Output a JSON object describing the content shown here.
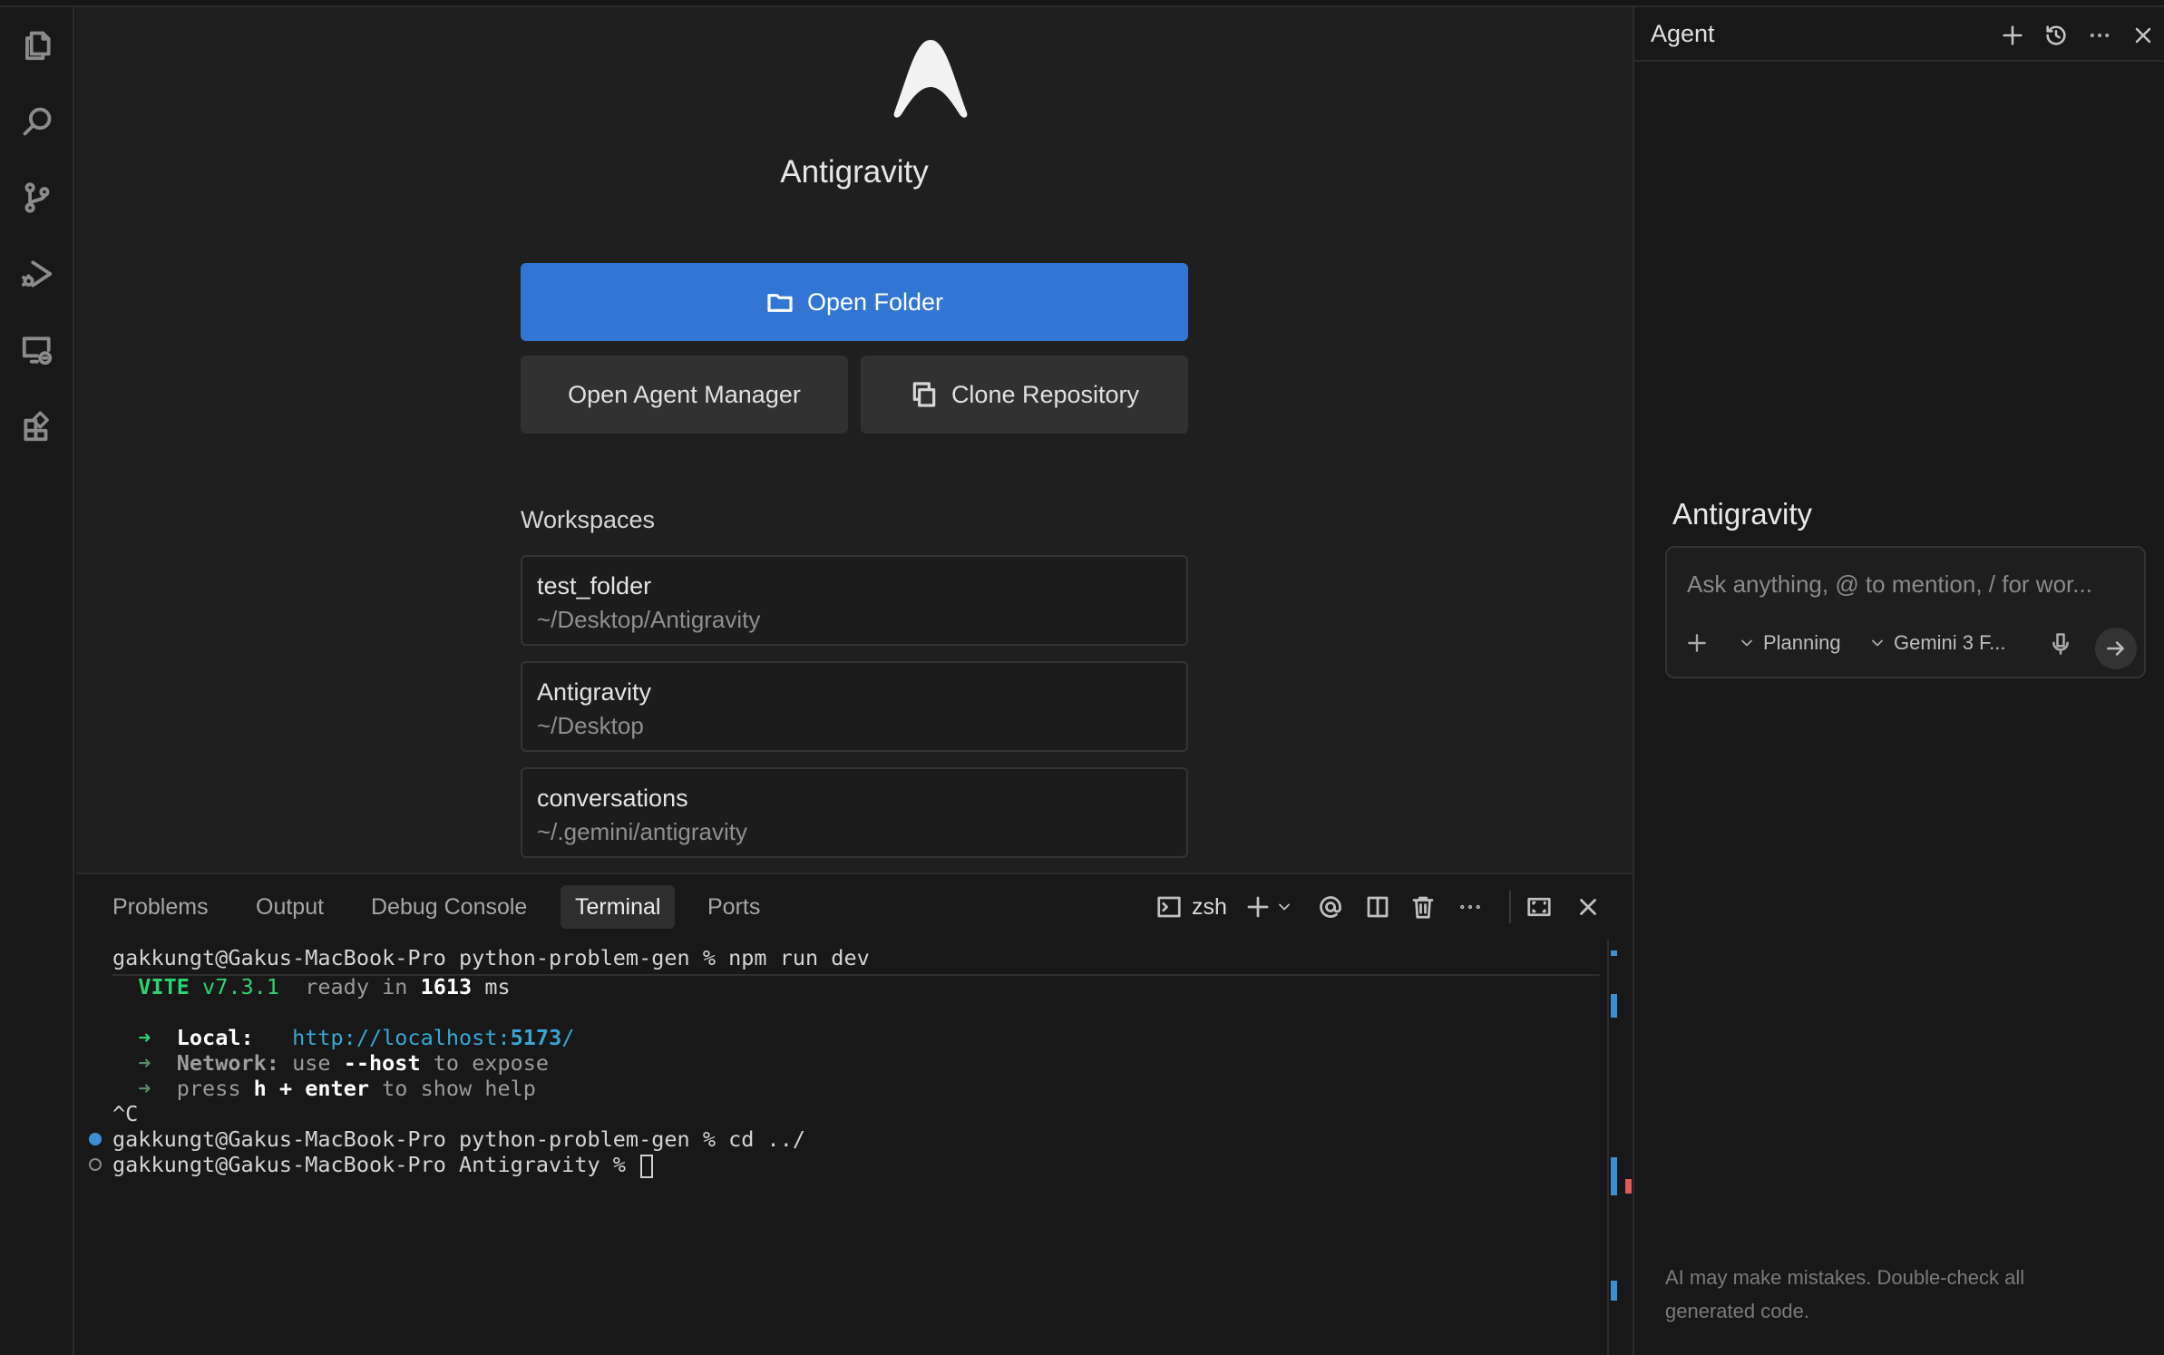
{
  "app": {
    "title": "Antigravity"
  },
  "activity_bar": {
    "icons": [
      "files-icon",
      "search-icon",
      "source-control-icon",
      "run-debug-icon",
      "remote-explorer-icon",
      "extensions-icon"
    ]
  },
  "welcome": {
    "title": "Antigravity",
    "open_folder": "Open Folder",
    "open_agent_manager": "Open Agent Manager",
    "clone_repository": "Clone Repository",
    "workspaces_title": "Workspaces",
    "workspaces": [
      {
        "name": "test_folder",
        "path": "~/Desktop/Antigravity"
      },
      {
        "name": "Antigravity",
        "path": "~/Desktop"
      },
      {
        "name": "conversations",
        "path": "~/.gemini/antigravity"
      }
    ]
  },
  "panel": {
    "tabs": [
      "Problems",
      "Output",
      "Debug Console",
      "Terminal",
      "Ports"
    ],
    "active_tab": "Terminal",
    "shell": "zsh"
  },
  "terminal": {
    "line1": "gakkungt@Gakus-MacBook-Pro python-problem-gen % npm run dev",
    "vite_name": "VITE",
    "vite_version": "v7.3.1",
    "vite_ready": "ready in",
    "vite_ms": "1613",
    "vite_ms_unit": "ms",
    "arrow": "➜",
    "local_label": "Local:",
    "local_url_prefix": "http://localhost:",
    "local_port": "5173",
    "local_url_suffix": "/",
    "network_label": "Network:",
    "network_use": "use",
    "network_flag": "--host",
    "network_rest": "to expose",
    "help_press": "press",
    "help_keys": "h + enter",
    "help_rest": "to show help",
    "ctrl_c": "^C",
    "line_cd": "gakkungt@Gakus-MacBook-Pro python-problem-gen % cd ../",
    "line_prompt": "gakkungt@Gakus-MacBook-Pro Antigravity % "
  },
  "agent": {
    "header_title": "Agent",
    "name": "Antigravity",
    "placeholder": "Ask anything, @ to mention, / for wor...",
    "mode": "Planning",
    "model": "Gemini 3 F...",
    "disclaimer": "AI may make mistakes. Double-check all generated code."
  },
  "colors": {
    "accent": "#3276d4",
    "terminal_green": "#2bd46e",
    "terminal_link": "#37a6d6"
  }
}
